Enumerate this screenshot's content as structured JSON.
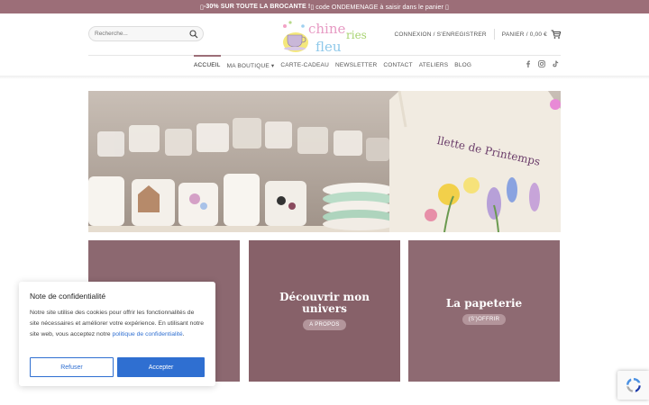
{
  "banner": {
    "prefix": "▯ ",
    "highlight": "-30% SUR TOUTE LA BROCANTE !",
    "suffix": " ▯ code ONDEMENAGE à saisir dans le panier ▯"
  },
  "search": {
    "placeholder": "Recherche..."
  },
  "logo": {
    "line1": "chine",
    "line2": "ries",
    "line3": "fleu"
  },
  "account": {
    "label": "CONNEXION / S'ENREGISTRER"
  },
  "cart": {
    "label": "PANIER / 0,00 €"
  },
  "nav": {
    "items": [
      {
        "label": "ACCUEIL"
      },
      {
        "label": "MA BOUTIQUE ▾"
      },
      {
        "label": "CARTE-CADEAU"
      },
      {
        "label": "NEWSLETTER"
      },
      {
        "label": "CONTACT"
      },
      {
        "label": "ATELIERS"
      },
      {
        "label": "BLOG"
      }
    ]
  },
  "hero": {
    "bag_text": "llette de Printemps"
  },
  "tiles": [
    {
      "title": "",
      "button": ""
    },
    {
      "title": "Découvrir mon univers",
      "button": "A PROPOS"
    },
    {
      "title": "La papeterie",
      "button": "(S')OFFRIR"
    }
  ],
  "cookie": {
    "title": "Note de confidentialité",
    "text": "Notre site utilise des cookies pour offrir les fonctionnalités de site nécessaires et améliorer votre expérience. En utilisant notre site web, vous acceptez notre ",
    "link": "politique de confidentialité",
    "end": ".",
    "refuse": "Refuser",
    "accept": "Accepter"
  },
  "colors": {
    "brand": "#9c6e78",
    "tile": "#8c6870",
    "accent_blue": "#2f6fd1"
  },
  "icons": [
    "search-icon",
    "cart-icon",
    "facebook-icon",
    "instagram-icon",
    "tiktok-icon",
    "recaptcha-icon"
  ]
}
